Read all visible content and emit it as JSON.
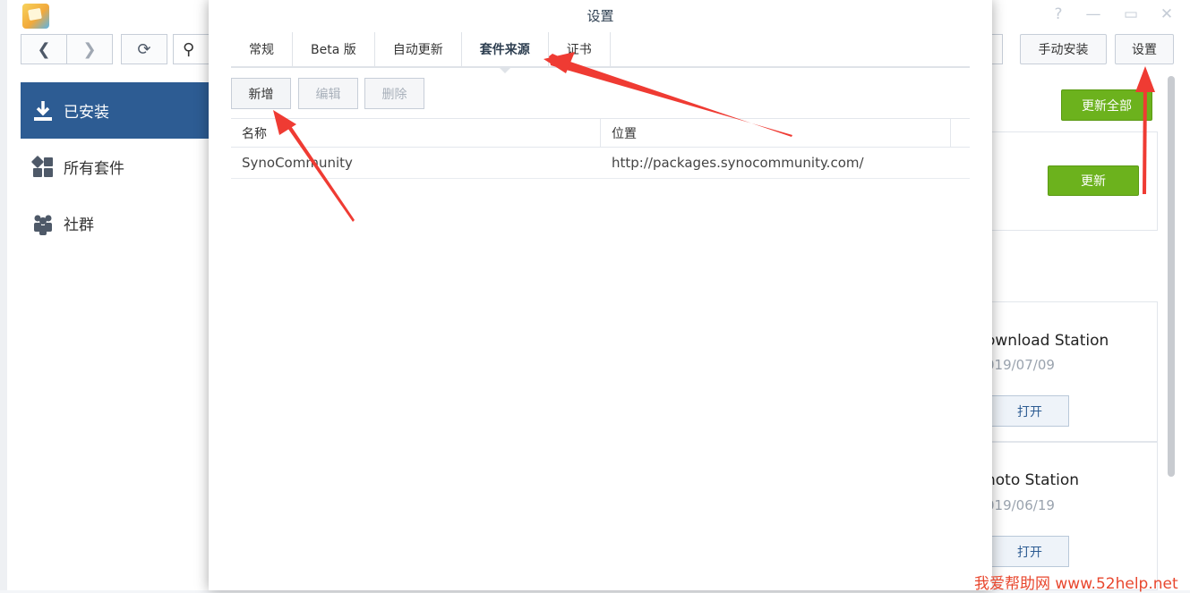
{
  "main_window": {
    "sidebar": {
      "items": [
        {
          "label": "已安装",
          "active": true
        },
        {
          "label": "所有套件",
          "active": false
        },
        {
          "label": "社群",
          "active": false
        }
      ]
    },
    "toolbar": {
      "manual_install_label": "手动安装",
      "settings_label": "设置"
    },
    "update_all_label": "更新全部",
    "update_label": "更新",
    "packages": [
      {
        "name": "ownload Station",
        "date": "019/07/09",
        "open_label": "打开"
      },
      {
        "name": "hoto Station",
        "date": "019/06/19",
        "open_label": "打开"
      }
    ]
  },
  "dialog": {
    "title": "设置",
    "tabs": [
      {
        "label": "常规",
        "active": false
      },
      {
        "label": "Beta 版",
        "active": false
      },
      {
        "label": "自动更新",
        "active": false
      },
      {
        "label": "套件来源",
        "active": true
      },
      {
        "label": "证书",
        "active": false
      }
    ],
    "buttons": {
      "add": "新增",
      "edit": "编辑",
      "delete": "删除"
    },
    "table": {
      "columns": [
        "名称",
        "位置"
      ],
      "rows": [
        {
          "name": "SynoCommunity",
          "location": "http://packages.synocommunity.com/"
        }
      ]
    }
  },
  "watermark": "我爱帮助网 www.52help.net",
  "colors": {
    "accent": "#2d5c93",
    "green": "#6cb21d",
    "arrow": "#ef3b33"
  }
}
